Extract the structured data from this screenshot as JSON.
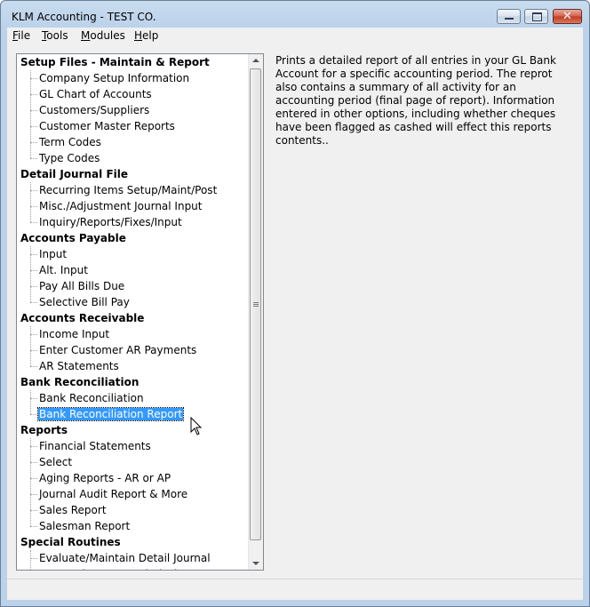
{
  "window": {
    "title": "KLM Accounting - TEST CO."
  },
  "menu": [
    {
      "mnemonic": "F",
      "rest": "ile"
    },
    {
      "mnemonic": "T",
      "rest": "ools"
    },
    {
      "mnemonic": "M",
      "rest": "odules"
    },
    {
      "mnemonic": "H",
      "rest": "elp"
    }
  ],
  "tree": {
    "items": [
      {
        "label": "Setup Files - Maintain & Report",
        "type": "header"
      },
      {
        "label": "Company Setup Information",
        "type": "child"
      },
      {
        "label": "GL Chart of Accounts",
        "type": "child"
      },
      {
        "label": "Customers/Suppliers",
        "type": "child"
      },
      {
        "label": "Customer Master Reports",
        "type": "child"
      },
      {
        "label": "Term Codes",
        "type": "child"
      },
      {
        "label": "Type Codes",
        "type": "child"
      },
      {
        "label": "Detail Journal File",
        "type": "header"
      },
      {
        "label": "Recurring Items Setup/Maint/Post",
        "type": "child"
      },
      {
        "label": "Misc./Adjustment Journal Input",
        "type": "child"
      },
      {
        "label": "Inquiry/Reports/Fixes/Input",
        "type": "child"
      },
      {
        "label": "Accounts Payable",
        "type": "header"
      },
      {
        "label": "Input",
        "type": "child"
      },
      {
        "label": "Alt. Input",
        "type": "child"
      },
      {
        "label": "Pay All Bills Due",
        "type": "child"
      },
      {
        "label": "Selective Bill Pay",
        "type": "child"
      },
      {
        "label": "Accounts Receivable",
        "type": "header"
      },
      {
        "label": "Income Input",
        "type": "child"
      },
      {
        "label": "Enter Customer AR Payments",
        "type": "child"
      },
      {
        "label": "AR Statements",
        "type": "child"
      },
      {
        "label": "Bank Reconciliation",
        "type": "header"
      },
      {
        "label": "Bank Reconciliation",
        "type": "child"
      },
      {
        "label": "Bank Reconciliation Report",
        "type": "child",
        "selected": true
      },
      {
        "label": "Reports",
        "type": "header"
      },
      {
        "label": "Financial Statements",
        "type": "child"
      },
      {
        "label": "Select",
        "type": "child"
      },
      {
        "label": "Aging Reports - AR or AP",
        "type": "child"
      },
      {
        "label": "Journal Audit Report & More",
        "type": "child"
      },
      {
        "label": "Sales Report",
        "type": "child"
      },
      {
        "label": "Salesman Report",
        "type": "child"
      },
      {
        "label": "Special Routines",
        "type": "header"
      },
      {
        "label": "Evaluate/Maintain Detail Journal",
        "type": "child"
      },
      {
        "label": "Accounting Year End Closing",
        "type": "child"
      }
    ]
  },
  "description": "Prints a detailed report of all entries in your GL Bank Account for a specific accounting period. The reprot also contains a summary of all activity for an accounting period (final page of report). Information entered in other options, including whether cheques have been flagged as cashed will effect this reports contents..",
  "colors": {
    "selection": "#3399ff",
    "titlebar": "#bcd2ea",
    "close_button": "#c03a22"
  },
  "icons": [
    "minimize-icon",
    "maximize-icon",
    "close-icon",
    "scroll-up-icon",
    "scroll-down-icon",
    "mouse-pointer-icon"
  ]
}
